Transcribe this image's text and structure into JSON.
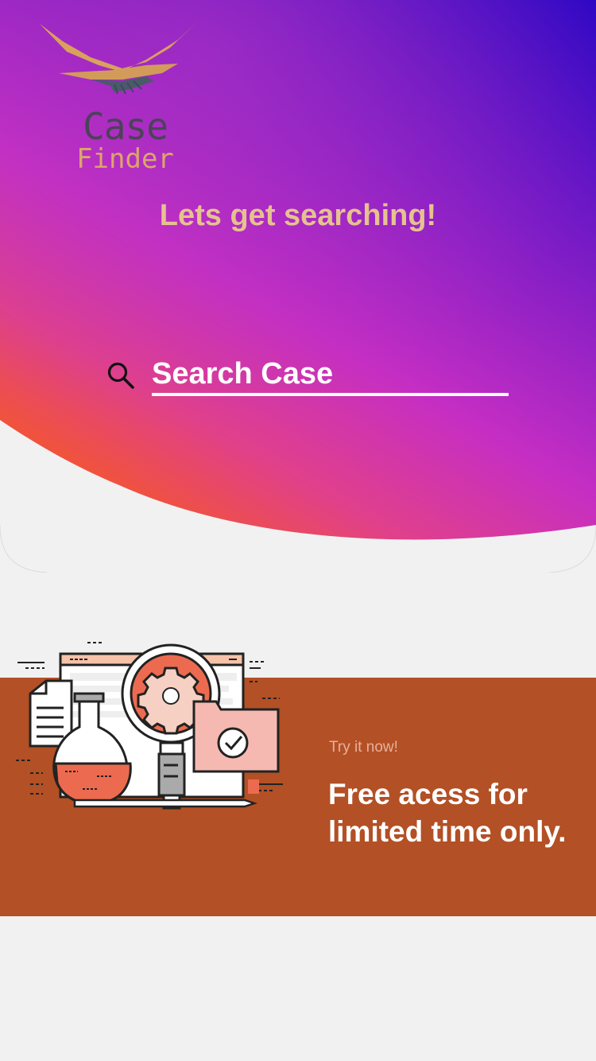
{
  "app": {
    "logo": {
      "word_top": "Case",
      "word_bottom": "Finder"
    },
    "tagline": "Lets get searching!"
  },
  "search": {
    "placeholder": "Search Case",
    "value": "",
    "icon": "search-icon"
  },
  "promo": {
    "kicker": "Try it now!",
    "headline_lines": [
      "Free acess for",
      "limited time only."
    ],
    "illustration": "lab-research-illustration"
  },
  "colors": {
    "hero_gradient": [
      "#2a06c4",
      "#9420c6",
      "#d8388a",
      "#ee4a4e"
    ],
    "accent_gold": "#e5c28e",
    "promo_band": "#b35025",
    "page_background": "#f1f1f1"
  }
}
